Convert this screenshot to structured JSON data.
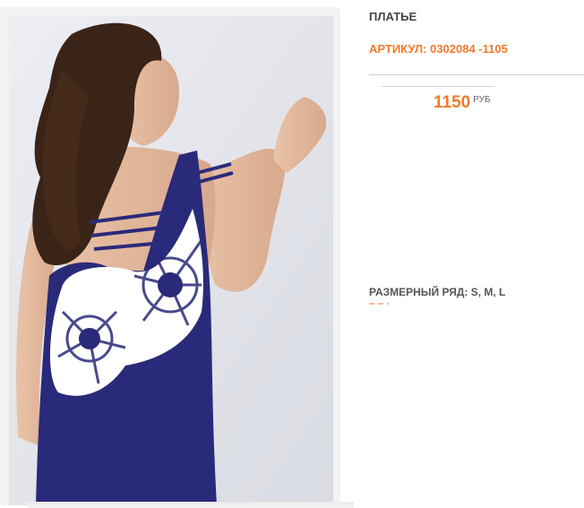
{
  "product": {
    "title": "ПЛАТЬЕ",
    "sku_label": "АРТИКУЛ: 0302084 -1105",
    "price": "1150",
    "currency": "РУБ",
    "sizes_label": "РАЗМЕРНЫЙ РЯД: S, M, L"
  },
  "image": {
    "icon": "product-photo",
    "dress_color": "#2a2a7a",
    "accent_color": "#f27a2c"
  }
}
